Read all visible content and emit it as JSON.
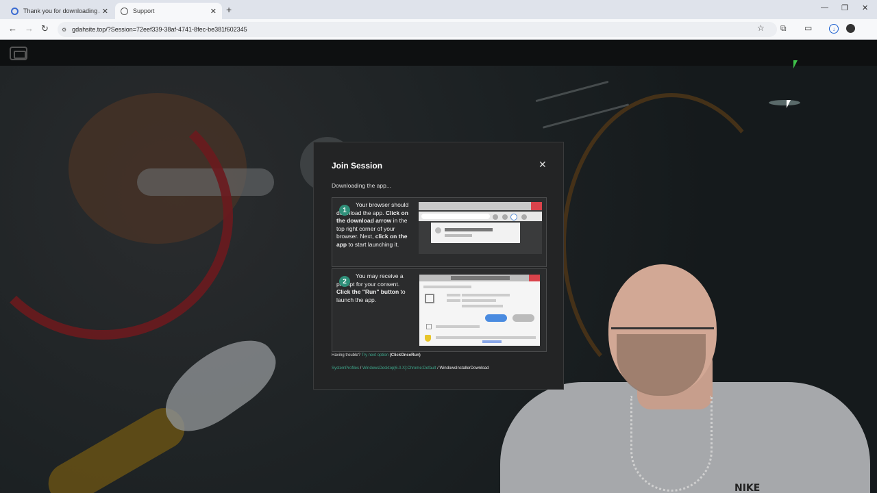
{
  "browser": {
    "tabs": [
      {
        "title": "Thank you for downloading An",
        "active": false
      },
      {
        "title": "Support",
        "active": true
      }
    ],
    "new_tab": "+",
    "url": "gdahsite.top/?Session=72eef339-38af-4741-8fec-be381f602345"
  },
  "modal": {
    "title": "Join Session",
    "close": "✕",
    "subtitle": "Downloading the app...",
    "steps": [
      {
        "number": "1",
        "text_parts": [
          "Your browser should download the app. ",
          "Click on the download arrow",
          " in the top right corner of your browser. Next, ",
          "click on the app",
          " to start launching it."
        ]
      },
      {
        "number": "2",
        "text_parts": [
          "You may receive a prompt for your consent. ",
          "Click the \"Run\" button",
          " to launch the app."
        ]
      }
    ],
    "trouble": {
      "prefix": "Having trouble?",
      "link": "Try next option",
      "suffix": "(ClickOnceRun)"
    },
    "breadcrumb": {
      "link1": "SystemProfiles",
      "sep": " / ",
      "link2": "WindowsDesktop[6.0.X]:Chrome:Default",
      "current": "WindowsInstallerDownload"
    }
  },
  "webcam": {
    "shirt_text": "NIKE"
  },
  "colors": {
    "accent": "#2f8f79",
    "link": "#3ea58a",
    "modal_bg": "#232425"
  }
}
